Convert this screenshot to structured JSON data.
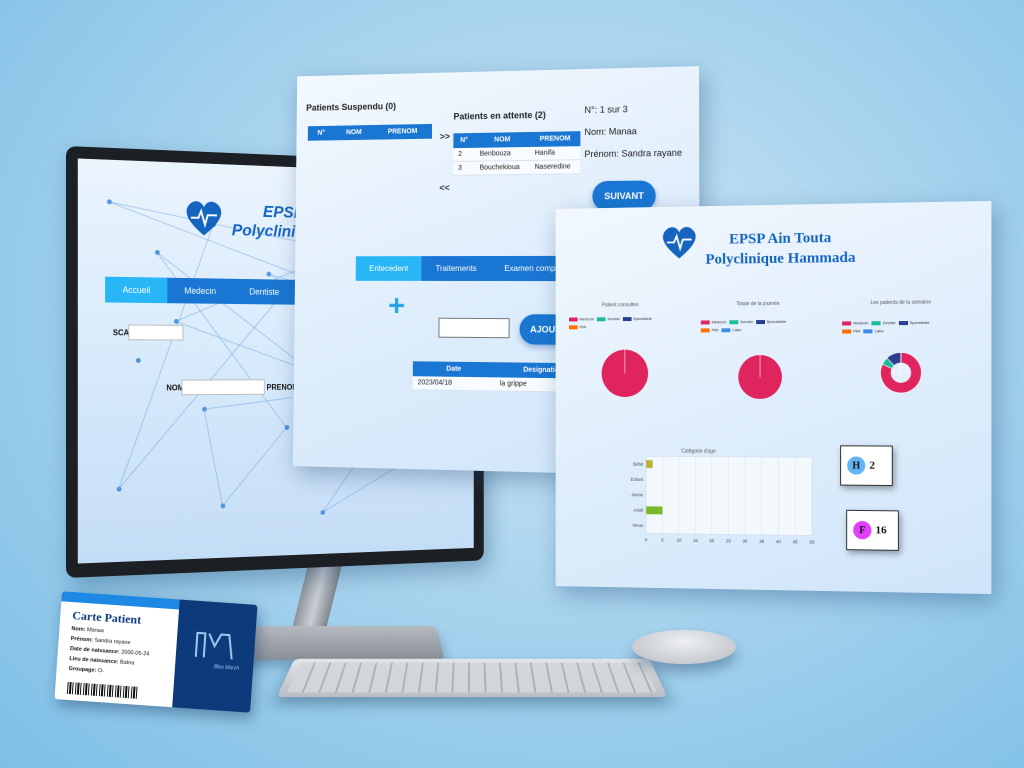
{
  "monitor": {
    "brand_line1": "EPSP",
    "brand_line2": "Polyclinique",
    "nav": [
      "Accueil",
      "Medecin",
      "Dentiste"
    ],
    "scan_label": "SCAN",
    "nom_label": "NOM",
    "prenom_label": "PRENOM"
  },
  "queue_panel": {
    "suspended_title": "Patients Suspendu (0)",
    "suspended_headers": [
      "N°",
      "NOM",
      "PRENOM"
    ],
    "waiting_title": "Patients en attente (2)",
    "waiting_headers": [
      "N°",
      "NOM",
      "PRENOM"
    ],
    "waiting_rows": [
      {
        "n": "2",
        "nom": "Benbouza",
        "prenom": "Hanifa"
      },
      {
        "n": "3",
        "nom": "Bouchekioua",
        "prenom": "Naseredine"
      }
    ],
    "move_right": ">>",
    "move_left": "<<",
    "counter": "N°: 1 sur 3",
    "nom_line": "Nom: Manaa",
    "prenom_line": "Prénom: Sandra rayane",
    "next_button": "SUIVANT",
    "tabs": [
      "Entecedent",
      "Traitements",
      "Examen complém"
    ],
    "add_button": "AJOUTER",
    "history_headers": [
      "Date",
      "Designation"
    ],
    "history_rows": [
      {
        "date": "2023/04/18",
        "designation": "la grippe"
      }
    ]
  },
  "dashboard": {
    "title_line1": "EPSP Ain Touta",
    "title_line2": "Polyclinique Hammada",
    "pie1_caption": "Patient consultes",
    "pie2_caption": "Totale de la journée",
    "pie3_caption": "Les patients de la semaine",
    "legend": [
      {
        "label": "Medecin",
        "color": "#e0245e"
      },
      {
        "label": "Dentist",
        "color": "#1abc9c"
      },
      {
        "label": "Specialiste",
        "color": "#2c3e8f"
      },
      {
        "label": "PMI",
        "color": "#ff6f00"
      },
      {
        "label": "Labo",
        "color": "#3a8ee6"
      }
    ],
    "bar_caption": "Catégorie d'age",
    "gender": [
      {
        "letter": "H",
        "count": "2",
        "color": "#64b5f6"
      },
      {
        "letter": "F",
        "count": "16",
        "color": "#e040fb"
      }
    ]
  },
  "chart_data": [
    {
      "type": "pie",
      "title": "Patient consultes",
      "categories": [
        "Medecin",
        "Dentist",
        "Specialiste",
        "PMI"
      ],
      "values": [
        100,
        0,
        0,
        0
      ]
    },
    {
      "type": "pie",
      "title": "Totale de la journée",
      "categories": [
        "Medecin",
        "Dentist",
        "Specialiste",
        "PMI",
        "Labo"
      ],
      "values": [
        100,
        0,
        0,
        0,
        0
      ]
    },
    {
      "type": "pie",
      "title": "Les patients de la semaine",
      "categories": [
        "Medecin",
        "Dentist",
        "Specialiste",
        "PMI",
        "Labo"
      ],
      "values": [
        82,
        6,
        12,
        0,
        0
      ]
    },
    {
      "type": "bar",
      "orientation": "horizontal",
      "title": "Catégorie d'age",
      "categories": [
        "Bébé",
        "Enfant",
        "Jeune",
        "Adult",
        "Vieux"
      ],
      "values": [
        2,
        0,
        0,
        5,
        0
      ],
      "colors": [
        "#bdb13a",
        "#bdb13a",
        "#bdb13a",
        "#7cb82a",
        "#7cb82a"
      ],
      "xticks": [
        0,
        5,
        10,
        15,
        20,
        25,
        30,
        35,
        40,
        45,
        50
      ],
      "xlim": [
        0,
        50
      ],
      "grid": true
    }
  ],
  "card": {
    "title": "Carte Patient",
    "nom": "Manaa",
    "prenom": "Sandra rayane",
    "date_naissance": "2000-05-24",
    "lieu_naissance": "Batna",
    "groupage": "O-",
    "nom_label": "Nom:",
    "prenom_label": "Prénom:",
    "date_label": "Date de naissance:",
    "lieu_label": "Lieu de naissance:",
    "groupage_label": "Groupage:",
    "brand": "Bleu March"
  }
}
